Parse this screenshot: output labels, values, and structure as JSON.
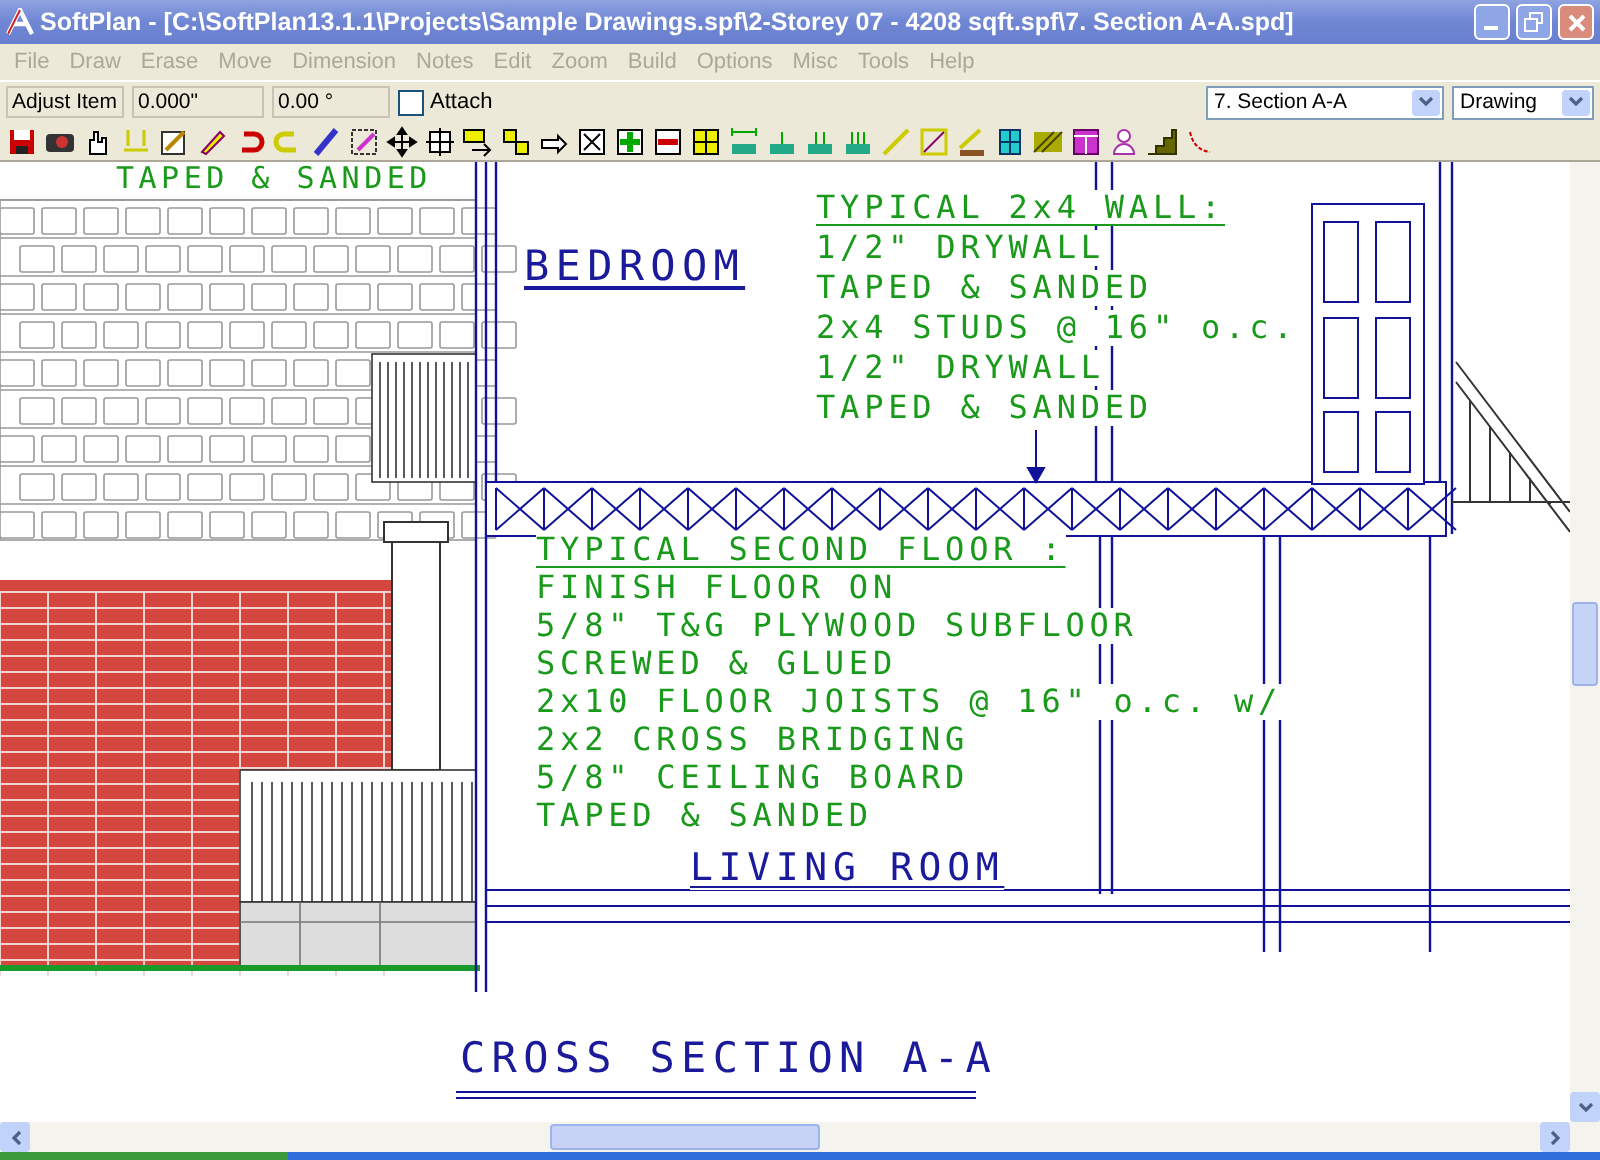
{
  "window": {
    "title": "SoftPlan - [C:\\SoftPlan13.1.1\\Projects\\Sample Drawings.spf\\2-Storey 07 - 4208 sqft.spf\\7. Section A-A.spd]"
  },
  "menu": [
    {
      "label": "File",
      "disabled": true
    },
    {
      "label": "Draw",
      "disabled": true
    },
    {
      "label": "Erase",
      "disabled": true
    },
    {
      "label": "Move",
      "disabled": true
    },
    {
      "label": "Dimension",
      "disabled": true
    },
    {
      "label": "Notes",
      "disabled": true
    },
    {
      "label": "Edit",
      "disabled": true
    },
    {
      "label": "Zoom",
      "disabled": true
    },
    {
      "label": "Build",
      "disabled": true
    },
    {
      "label": "Options",
      "disabled": true
    },
    {
      "label": "Misc",
      "disabled": true
    },
    {
      "label": "Tools",
      "disabled": true
    },
    {
      "label": "Help",
      "disabled": true
    }
  ],
  "edit_bar": {
    "mode": "Adjust Item",
    "length": "0.000\"",
    "angle": "0.00 °",
    "attach": {
      "label": "Attach",
      "checked": false
    },
    "view_select": "7. Section A-A",
    "layer_select": "Drawing"
  },
  "drawing": {
    "top_note": "TAPED & SANDED",
    "bedroom_label": "BEDROOM",
    "wall_note": {
      "heading": "TYPICAL 2x4 WALL:",
      "lines": [
        "1/2\" DRYWALL",
        "TAPED & SANDED",
        "2x4 STUDS @ 16\" o.c.",
        "1/2\" DRYWALL",
        "TAPED & SANDED"
      ]
    },
    "floor_note": {
      "heading": "TYPICAL SECOND FLOOR :",
      "lines": [
        "FINISH FLOOR ON",
        "5/8\" T&G PLYWOOD SUBFLOOR",
        "SCREWED & GLUED",
        "2x10 FLOOR JOISTS @ 16\" o.c. w/",
        "2x2 CROSS BRIDGING",
        "5/8\" CEILING BOARD",
        "TAPED & SANDED"
      ]
    },
    "living_room_label": "LIVING ROOM",
    "section_title": "CROSS SECTION A-A"
  }
}
